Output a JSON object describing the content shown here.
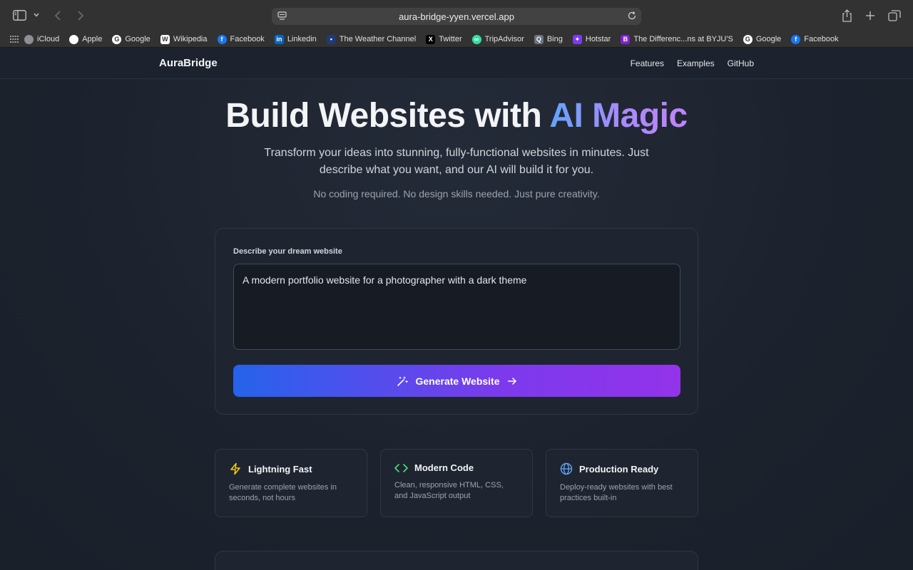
{
  "browser": {
    "url": "aura-bridge-yyen.vercel.app",
    "bookmarks": [
      {
        "label": "iCloud",
        "icon": "apple-icon",
        "color": "#8e8e93",
        "glyph": ""
      },
      {
        "label": "Apple",
        "icon": "apple-icon",
        "color": "#ffffff",
        "glyph": ""
      },
      {
        "label": "Google",
        "icon": "google-icon",
        "color": "#ffffff",
        "glyph": "G"
      },
      {
        "label": "Wikipedia",
        "icon": "wikipedia-icon",
        "color": "#ffffff",
        "glyph": "W"
      },
      {
        "label": "Facebook",
        "icon": "facebook-icon",
        "color": "#1877f2",
        "glyph": "f"
      },
      {
        "label": "Linkedin",
        "icon": "linkedin-icon",
        "color": "#0a66c2",
        "glyph": "in"
      },
      {
        "label": "The Weather Channel",
        "icon": "weather-channel-icon",
        "color": "#1f3b73",
        "glyph": "▪"
      },
      {
        "label": "Twitter",
        "icon": "x-icon",
        "color": "#000000",
        "glyph": "X"
      },
      {
        "label": "TripAdvisor",
        "icon": "tripadvisor-icon",
        "color": "#34e0a1",
        "glyph": "∞"
      },
      {
        "label": "Bing",
        "icon": "bing-icon",
        "color": "#6b7280",
        "glyph": "Q"
      },
      {
        "label": "Hotstar",
        "icon": "hotstar-icon",
        "color": "#7c3aed",
        "glyph": "✦"
      },
      {
        "label": "The Differenc...ns at BYJU'S",
        "icon": "byjus-icon",
        "color": "#7e22ce",
        "glyph": "B"
      },
      {
        "label": "Google",
        "icon": "google-icon",
        "color": "#ffffff",
        "glyph": "G"
      },
      {
        "label": "Facebook",
        "icon": "facebook-icon",
        "color": "#1877f2",
        "glyph": "f"
      }
    ]
  },
  "nav": {
    "brand": "AuraBridge",
    "links": [
      "Features",
      "Examples",
      "GitHub"
    ]
  },
  "hero": {
    "title_plain": "Build Websites with ",
    "title_gradient": "AI Magic",
    "subtitle": "Transform your ideas into stunning, fully-functional websites in minutes. Just describe what you want, and our AI will build it for you.",
    "tagline": "No coding required. No design skills needed. Just pure creativity."
  },
  "form": {
    "label": "Describe your dream website",
    "value": "A modern portfolio website for a photographer with a dark theme",
    "button_label": "Generate Website"
  },
  "features": [
    {
      "title": "Lightning Fast",
      "desc": "Generate complete websites in seconds, not hours",
      "icon": "lightning-icon",
      "color": "#facc15"
    },
    {
      "title": "Modern Code",
      "desc": "Clean, responsive HTML, CSS, and JavaScript output",
      "icon": "code-icon",
      "color": "#4ade80"
    },
    {
      "title": "Production Ready",
      "desc": "Deploy-ready websites with best practices built-in",
      "icon": "globe-icon",
      "color": "#60a5fa"
    }
  ]
}
